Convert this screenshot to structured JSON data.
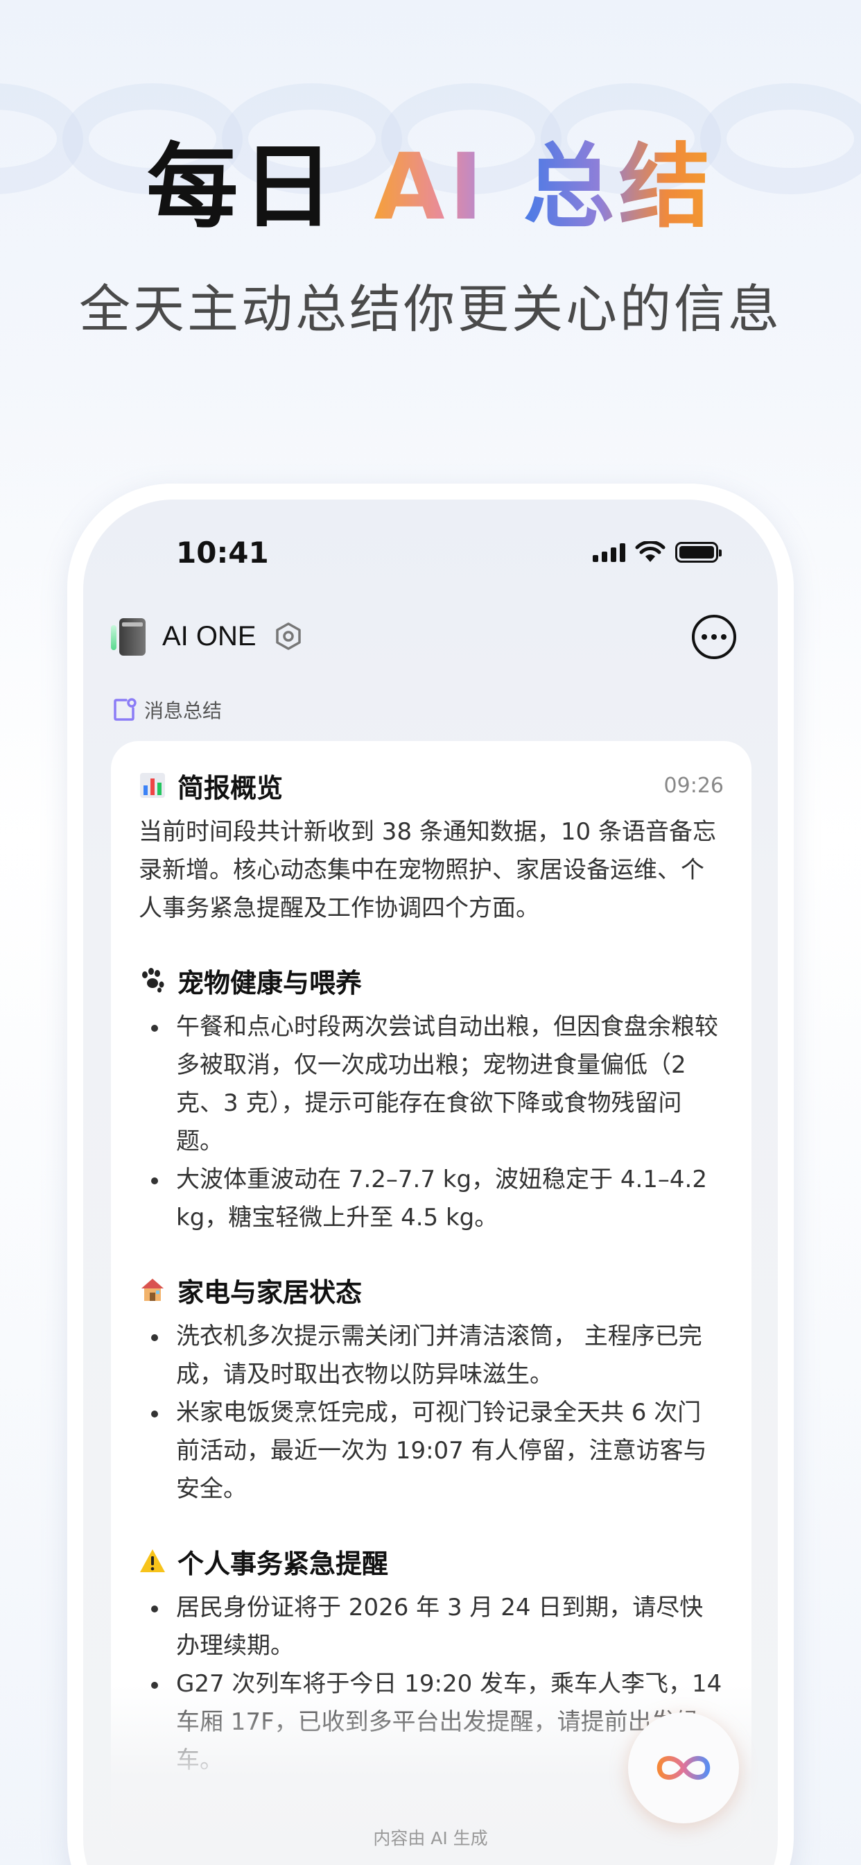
{
  "promo": {
    "title_part1": "每日",
    "title_part2": "AI",
    "title_part3": "总结",
    "subtitle": "全天主动总结你更关心的信息"
  },
  "status_bar": {
    "time": "10:41"
  },
  "app": {
    "name": "AI ONE"
  },
  "section": {
    "label": "消息总结"
  },
  "card": {
    "title": "简报概览",
    "time": "09:26",
    "overview": "当前时间段共计新收到 38 条通知数据，10 条语音备忘录新增。核心动态集中在宠物照护、家居设备运维、个人事务紧急提醒及工作协调四个方面。",
    "sections": [
      {
        "icon": "paw-icon",
        "title": "宠物健康与喂养",
        "bullets": [
          "午餐和点心时段两次尝试自动出粮，但因食盘余粮较多被取消，仅一次成功出粮；宠物进食量偏低（2 克、3 克），提示可能存在食欲下降或食物残留问题。",
          "大波体重波动在 7.2–7.7 kg，波妞稳定于 4.1–4.2 kg，糖宝轻微上升至 4.5 kg。"
        ]
      },
      {
        "icon": "house-icon",
        "title": "家电与家居状态",
        "bullets": [
          "洗衣机多次提示需关闭门并清洁滚筒， 主程序已完成，请及时取出衣物以防异味滋生。",
          "米家电饭煲烹饪完成，可视门铃记录全天共 6 次门前活动，最近一次为 19:07 有人停留，注意访客与安全。"
        ]
      },
      {
        "icon": "warning-icon",
        "title": "个人事务紧急提醒",
        "bullets": [
          "居民身份证将于 2026 年 3 月 24 日到期，请尽快办理续期。",
          "G27 次列车将于今日 19:20 发车，乘车人李飞，14 车厢 17F，已收到多平台出发提醒，请提前出发候车。"
        ]
      }
    ]
  },
  "footer": {
    "note": "内容由 AI 生成"
  },
  "colors": {
    "accent_orange": "#f39a2e",
    "accent_blue": "#4b7be6",
    "section_icon": "#8b7cf6"
  }
}
